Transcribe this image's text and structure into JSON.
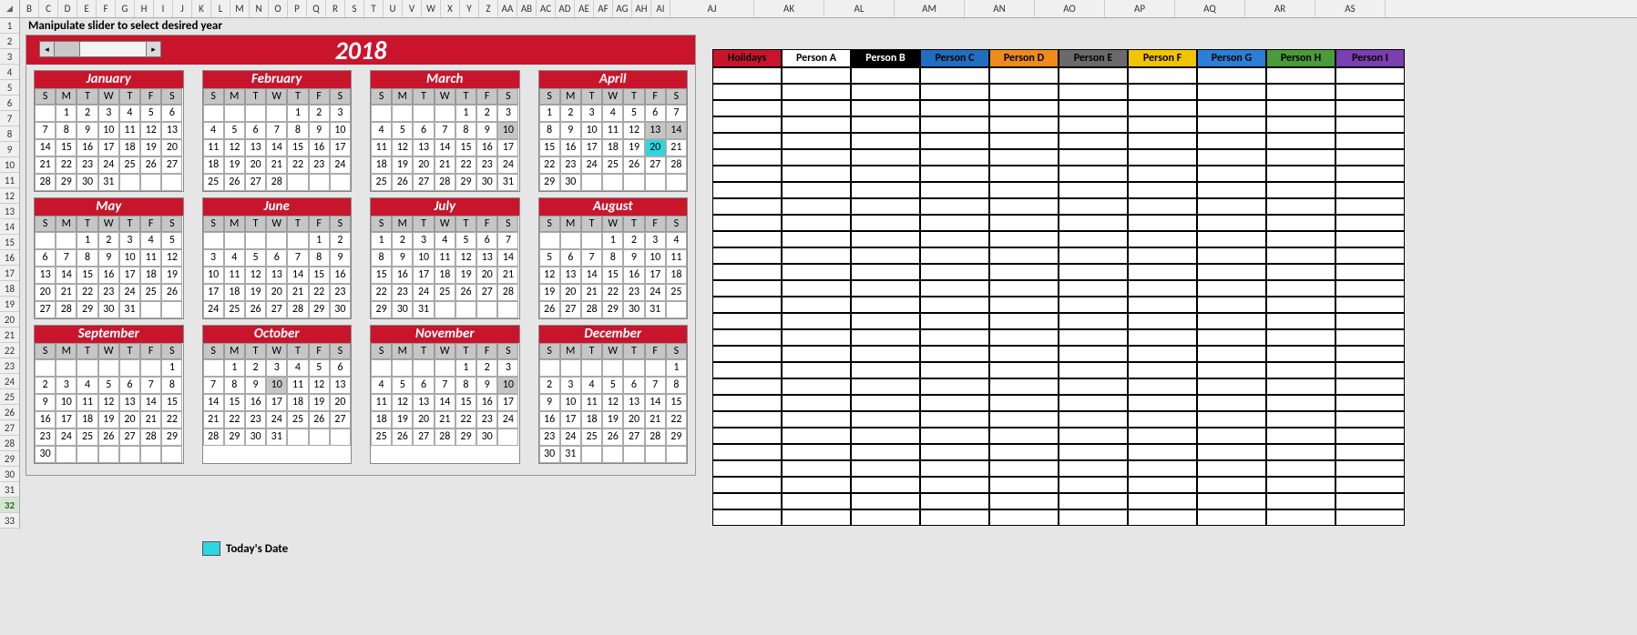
{
  "instruction": "Manipulate slider to select desired year",
  "year": "2018",
  "todays_date_label": "Today's Date",
  "today": {
    "month": 3,
    "day": 20
  },
  "col_letters_narrow": [
    "B",
    "C",
    "D",
    "E",
    "F",
    "G",
    "H",
    "I",
    "J",
    "K",
    "L",
    "M",
    "N",
    "O",
    "P",
    "Q",
    "R",
    "S",
    "T",
    "U",
    "V",
    "W",
    "X",
    "Y",
    "Z",
    "AA",
    "AB",
    "AC",
    "AD",
    "AE",
    "AF",
    "AG",
    "AH",
    "AI"
  ],
  "col_letters_wide": [
    "AJ",
    "AK",
    "AL",
    "AM",
    "AN",
    "AO",
    "AP",
    "AQ",
    "AR",
    "AS"
  ],
  "row_nums": [
    "1",
    "2",
    "3",
    "4",
    "5",
    "6",
    "7",
    "8",
    "9",
    "10",
    "11",
    "12",
    "13",
    "14",
    "15",
    "16",
    "17",
    "18",
    "19",
    "20",
    "21",
    "22",
    "23",
    "24",
    "25",
    "26",
    "27",
    "28",
    "29",
    "30",
    "31",
    "32",
    "33"
  ],
  "day_labels": [
    "S",
    "M",
    "T",
    "W",
    "T",
    "F",
    "S"
  ],
  "months": [
    {
      "name": "January",
      "weeks": [
        [
          "",
          "1",
          "2",
          "3",
          "4",
          "5",
          "6"
        ],
        [
          "7",
          "8",
          "9",
          "10",
          "11",
          "12",
          "13"
        ],
        [
          "14",
          "15",
          "16",
          "17",
          "18",
          "19",
          "20"
        ],
        [
          "21",
          "22",
          "23",
          "24",
          "25",
          "26",
          "27"
        ],
        [
          "28",
          "29",
          "30",
          "31",
          "",
          "",
          ""
        ]
      ]
    },
    {
      "name": "February",
      "weeks": [
        [
          "",
          "",
          "",
          "",
          "1",
          "2",
          "3"
        ],
        [
          "4",
          "5",
          "6",
          "7",
          "8",
          "9",
          "10"
        ],
        [
          "11",
          "12",
          "13",
          "14",
          "15",
          "16",
          "17"
        ],
        [
          "18",
          "19",
          "20",
          "21",
          "22",
          "23",
          "24"
        ],
        [
          "25",
          "26",
          "27",
          "28",
          "",
          "",
          ""
        ]
      ]
    },
    {
      "name": "March",
      "weeks": [
        [
          "",
          "",
          "",
          "",
          "1",
          "2",
          "3"
        ],
        [
          "4",
          "5",
          "6",
          "7",
          "8",
          "9",
          "10"
        ],
        [
          "11",
          "12",
          "13",
          "14",
          "15",
          "16",
          "17"
        ],
        [
          "18",
          "19",
          "20",
          "21",
          "22",
          "23",
          "24"
        ],
        [
          "25",
          "26",
          "27",
          "28",
          "29",
          "30",
          "31"
        ]
      ]
    },
    {
      "name": "April",
      "weeks": [
        [
          "1",
          "2",
          "3",
          "4",
          "5",
          "6",
          "7"
        ],
        [
          "8",
          "9",
          "10",
          "11",
          "12",
          "13",
          "14"
        ],
        [
          "15",
          "16",
          "17",
          "18",
          "19",
          "20",
          "21"
        ],
        [
          "22",
          "23",
          "24",
          "25",
          "26",
          "27",
          "28"
        ],
        [
          "29",
          "30",
          "",
          "",
          "",
          "",
          ""
        ]
      ]
    },
    {
      "name": "May",
      "weeks": [
        [
          "",
          "",
          "1",
          "2",
          "3",
          "4",
          "5"
        ],
        [
          "6",
          "7",
          "8",
          "9",
          "10",
          "11",
          "12"
        ],
        [
          "13",
          "14",
          "15",
          "16",
          "17",
          "18",
          "19"
        ],
        [
          "20",
          "21",
          "22",
          "23",
          "24",
          "25",
          "26"
        ],
        [
          "27",
          "28",
          "29",
          "30",
          "31",
          "",
          ""
        ]
      ]
    },
    {
      "name": "June",
      "weeks": [
        [
          "",
          "",
          "",
          "",
          "",
          "1",
          "2"
        ],
        [
          "3",
          "4",
          "5",
          "6",
          "7",
          "8",
          "9"
        ],
        [
          "10",
          "11",
          "12",
          "13",
          "14",
          "15",
          "16"
        ],
        [
          "17",
          "18",
          "19",
          "20",
          "21",
          "22",
          "23"
        ],
        [
          "24",
          "25",
          "26",
          "27",
          "28",
          "29",
          "30"
        ]
      ]
    },
    {
      "name": "July",
      "weeks": [
        [
          "1",
          "2",
          "3",
          "4",
          "5",
          "6",
          "7"
        ],
        [
          "8",
          "9",
          "10",
          "11",
          "12",
          "13",
          "14"
        ],
        [
          "15",
          "16",
          "17",
          "18",
          "19",
          "20",
          "21"
        ],
        [
          "22",
          "23",
          "24",
          "25",
          "26",
          "27",
          "28"
        ],
        [
          "29",
          "30",
          "31",
          "",
          "",
          "",
          ""
        ]
      ]
    },
    {
      "name": "August",
      "weeks": [
        [
          "",
          "",
          "",
          "1",
          "2",
          "3",
          "4"
        ],
        [
          "5",
          "6",
          "7",
          "8",
          "9",
          "10",
          "11"
        ],
        [
          "12",
          "13",
          "14",
          "15",
          "16",
          "17",
          "18"
        ],
        [
          "19",
          "20",
          "21",
          "22",
          "23",
          "24",
          "25"
        ],
        [
          "26",
          "27",
          "28",
          "29",
          "30",
          "31",
          ""
        ]
      ]
    },
    {
      "name": "September",
      "weeks": [
        [
          "",
          "",
          "",
          "",
          "",
          "",
          "1"
        ],
        [
          "2",
          "3",
          "4",
          "5",
          "6",
          "7",
          "8"
        ],
        [
          "9",
          "10",
          "11",
          "12",
          "13",
          "14",
          "15"
        ],
        [
          "16",
          "17",
          "18",
          "19",
          "20",
          "21",
          "22"
        ],
        [
          "23",
          "24",
          "25",
          "26",
          "27",
          "28",
          "29"
        ],
        [
          "30",
          "",
          "",
          "",
          "",
          "",
          ""
        ]
      ]
    },
    {
      "name": "October",
      "weeks": [
        [
          "",
          "1",
          "2",
          "3",
          "4",
          "5",
          "6"
        ],
        [
          "7",
          "8",
          "9",
          "10",
          "11",
          "12",
          "13"
        ],
        [
          "14",
          "15",
          "16",
          "17",
          "18",
          "19",
          "20"
        ],
        [
          "21",
          "22",
          "23",
          "24",
          "25",
          "26",
          "27"
        ],
        [
          "28",
          "29",
          "30",
          "31",
          "",
          "",
          ""
        ]
      ]
    },
    {
      "name": "November",
      "weeks": [
        [
          "",
          "",
          "",
          "",
          "1",
          "2",
          "3"
        ],
        [
          "4",
          "5",
          "6",
          "7",
          "8",
          "9",
          "10"
        ],
        [
          "11",
          "12",
          "13",
          "14",
          "15",
          "16",
          "17"
        ],
        [
          "18",
          "19",
          "20",
          "21",
          "22",
          "23",
          "24"
        ],
        [
          "25",
          "26",
          "27",
          "28",
          "29",
          "30",
          ""
        ]
      ]
    },
    {
      "name": "December",
      "weeks": [
        [
          "",
          "",
          "",
          "",
          "",
          "",
          "1"
        ],
        [
          "2",
          "3",
          "4",
          "5",
          "6",
          "7",
          "8"
        ],
        [
          "9",
          "10",
          "11",
          "12",
          "13",
          "14",
          "15"
        ],
        [
          "16",
          "17",
          "18",
          "19",
          "20",
          "21",
          "22"
        ],
        [
          "23",
          "24",
          "25",
          "26",
          "27",
          "28",
          "29"
        ],
        [
          "30",
          "31",
          "",
          "",
          "",
          "",
          ""
        ]
      ]
    }
  ],
  "persons": [
    {
      "label": "Holidays",
      "bg": "#c8152c",
      "fg": "#000"
    },
    {
      "label": "Person A",
      "bg": "#ffffff",
      "fg": "#000"
    },
    {
      "label": "Person B",
      "bg": "#000000",
      "fg": "#fff"
    },
    {
      "label": "Person C",
      "bg": "#1f6fc0",
      "fg": "#000"
    },
    {
      "label": "Person D",
      "bg": "#ed8b1c",
      "fg": "#000"
    },
    {
      "label": "Person E",
      "bg": "#6a6a6a",
      "fg": "#000"
    },
    {
      "label": "Person F",
      "bg": "#f2c400",
      "fg": "#000"
    },
    {
      "label": "Person G",
      "bg": "#2b7fd6",
      "fg": "#000"
    },
    {
      "label": "Person H",
      "bg": "#4a9b3a",
      "fg": "#000"
    },
    {
      "label": "Person I",
      "bg": "#7a3fb0",
      "fg": "#000"
    }
  ],
  "person_rows": 28
}
